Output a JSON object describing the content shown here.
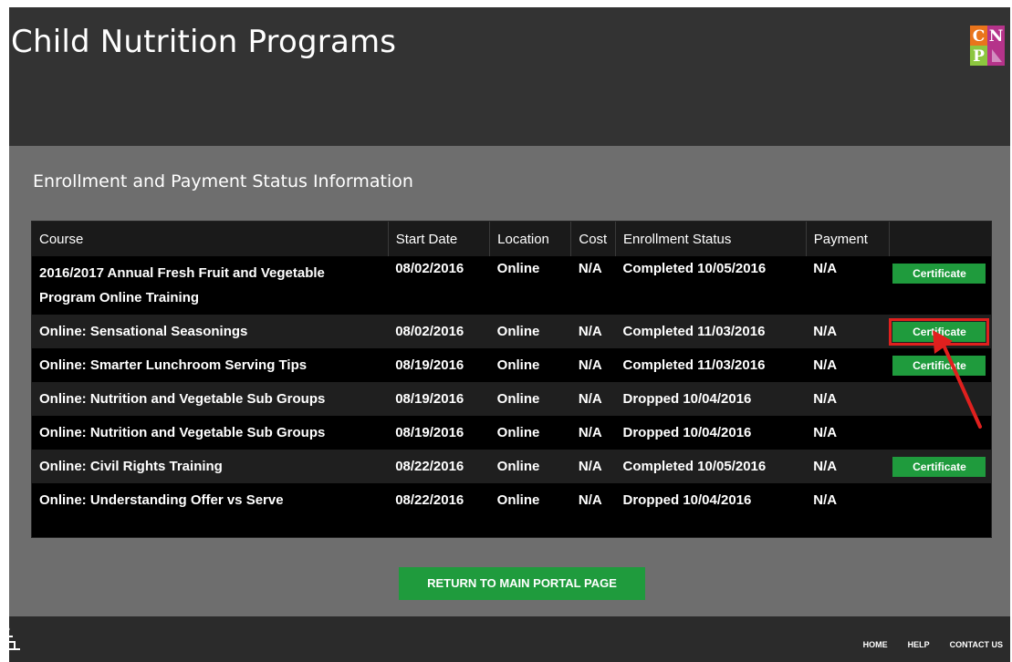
{
  "app": {
    "title": "Child Nutrition Programs",
    "logo": {
      "letters": [
        "C",
        "N",
        "P"
      ],
      "icon": "cnp-logo-icon"
    }
  },
  "section": {
    "title": "Enrollment and Payment Status Information"
  },
  "table": {
    "headers": [
      "Course",
      "Start Date",
      "Location",
      "Cost",
      "Enrollment Status",
      "Payment",
      ""
    ],
    "rows": [
      {
        "course": "2016/2017 Annual Fresh Fruit and Vegetable Program Online Training",
        "start_date": "08/02/2016",
        "location": "Online",
        "cost": "N/A",
        "status": "Completed 10/05/2016",
        "payment": "N/A",
        "action": "Certificate"
      },
      {
        "course": "Online: Sensational Seasonings",
        "start_date": "08/02/2016",
        "location": "Online",
        "cost": "N/A",
        "status": "Completed 11/03/2016",
        "payment": "N/A",
        "action": "Certificate"
      },
      {
        "course": "Online: Smarter Lunchroom Serving Tips",
        "start_date": "08/19/2016",
        "location": "Online",
        "cost": "N/A",
        "status": "Completed 11/03/2016",
        "payment": "N/A",
        "action": "Certificate"
      },
      {
        "course": "Online: Nutrition and Vegetable Sub Groups",
        "start_date": "08/19/2016",
        "location": "Online",
        "cost": "N/A",
        "status": "Dropped 10/04/2016",
        "payment": "N/A",
        "action": ""
      },
      {
        "course": "Online: Nutrition and Vegetable Sub Groups",
        "start_date": "08/19/2016",
        "location": "Online",
        "cost": "N/A",
        "status": "Dropped 10/04/2016",
        "payment": "N/A",
        "action": ""
      },
      {
        "course": "Online: Civil Rights Training",
        "start_date": "08/22/2016",
        "location": "Online",
        "cost": "N/A",
        "status": "Completed 10/05/2016",
        "payment": "N/A",
        "action": "Certificate"
      },
      {
        "course": "Online: Understanding Offer vs Serve",
        "start_date": "08/22/2016",
        "location": "Online",
        "cost": "N/A",
        "status": "Dropped 10/04/2016",
        "payment": "N/A",
        "action": ""
      }
    ]
  },
  "return_button": {
    "label": "RETURN TO MAIN PORTAL PAGE"
  },
  "footer": {
    "links": [
      "HOME",
      "HELP",
      "CONTACT US"
    ],
    "accessibility_icon": "accessibility-icon"
  },
  "colors": {
    "header_bg": "#333333",
    "main_bg": "#6e6e6e",
    "table_bg": "#000000",
    "button_green": "#1f9b3d",
    "annotation_red": "#e0201e"
  }
}
